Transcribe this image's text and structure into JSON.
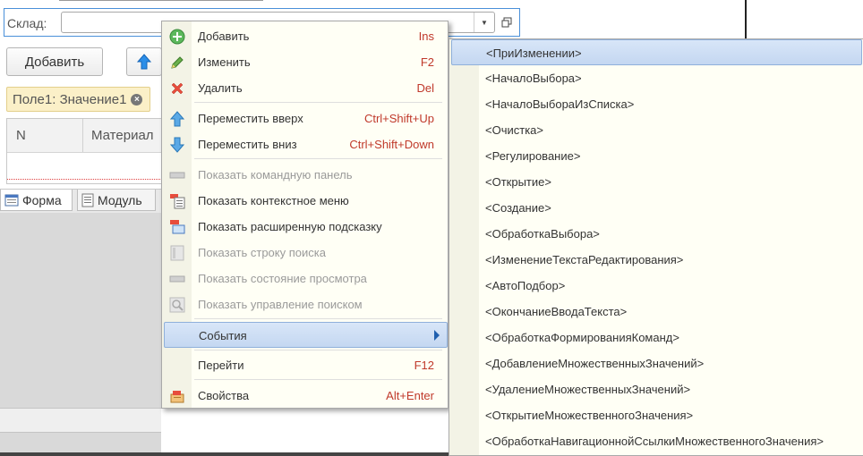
{
  "form": {
    "field_label": "Склад:",
    "add_button": "Добавить",
    "filter_chip": "Поле1: Значение1",
    "columns": [
      "N",
      "Материал"
    ],
    "tabs": [
      {
        "label": "Форма",
        "icon": "form-icon"
      },
      {
        "label": "Модуль",
        "icon": "module-icon"
      }
    ]
  },
  "context_menu": {
    "items": [
      {
        "label": "Добавить",
        "shortcut": "Ins",
        "icon": "add-icon",
        "enabled": true
      },
      {
        "label": "Изменить",
        "shortcut": "F2",
        "icon": "edit-icon",
        "enabled": true
      },
      {
        "label": "Удалить",
        "shortcut": "Del",
        "icon": "delete-icon",
        "enabled": true
      },
      {
        "label": "Переместить вверх",
        "shortcut": "Ctrl+Shift+Up",
        "icon": "move-up-icon",
        "enabled": true
      },
      {
        "label": "Переместить вниз",
        "shortcut": "Ctrl+Shift+Down",
        "icon": "move-down-icon",
        "enabled": true
      },
      {
        "label": "Показать командную панель",
        "shortcut": "",
        "icon": "command-panel-icon",
        "enabled": false
      },
      {
        "label": "Показать контекстное меню",
        "shortcut": "",
        "icon": "context-menu-icon",
        "enabled": true
      },
      {
        "label": "Показать расширенную подсказку",
        "shortcut": "",
        "icon": "extended-tooltip-icon",
        "enabled": true
      },
      {
        "label": "Показать строку поиска",
        "shortcut": "",
        "icon": "search-string-icon",
        "enabled": false
      },
      {
        "label": "Показать состояние просмотра",
        "shortcut": "",
        "icon": "view-state-icon",
        "enabled": false
      },
      {
        "label": "Показать управление поиском",
        "shortcut": "",
        "icon": "search-control-icon",
        "enabled": false
      },
      {
        "label": "События",
        "shortcut": "",
        "icon": "",
        "enabled": true
      },
      {
        "label": "Перейти",
        "shortcut": "F12",
        "icon": "",
        "enabled": true
      },
      {
        "label": "Свойства",
        "shortcut": "Alt+Enter",
        "icon": "properties-icon",
        "enabled": true
      }
    ]
  },
  "events_submenu": {
    "items": [
      "<ПриИзменении>",
      "<НачалоВыбора>",
      "<НачалоВыбораИзСписка>",
      "<Очистка>",
      "<Регулирование>",
      "<Открытие>",
      "<Создание>",
      "<ОбработкаВыбора>",
      "<ИзменениеТекстаРедактирования>",
      "<АвтоПодбор>",
      "<ОкончаниеВводаТекста>",
      "<ОбработкаФормированияКоманд>",
      "<ДобавлениеМножественныхЗначений>",
      "<УдалениеМножественныхЗначений>",
      "<ОткрытиеМножественногоЗначения>",
      "<ОбработкаНавигационнойСсылкиМножественногоЗначения>"
    ]
  },
  "colors": {
    "accent": "#4a90d9",
    "shortcut": "#c0392b",
    "menu_bg": "#fffff5",
    "selection": "#c4d7f1"
  }
}
